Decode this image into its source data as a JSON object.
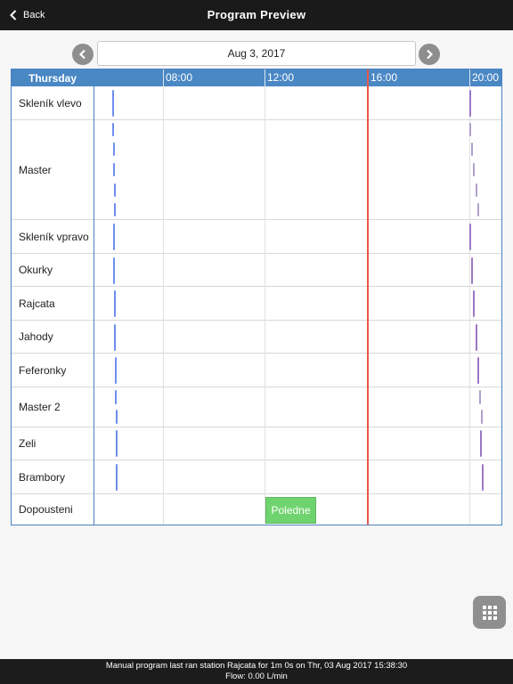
{
  "nav": {
    "back_label": "Back",
    "title": "Program Preview"
  },
  "date": {
    "value": "Aug 3, 2017"
  },
  "grid": {
    "day_label": "Thursday",
    "time_labels": [
      "08:00",
      "12:00",
      "16:00",
      "20:00"
    ],
    "rows": [
      {
        "label": "Skleník vlevo"
      },
      {
        "label": "Master"
      },
      {
        "label": "Skleník vpravo"
      },
      {
        "label": "Okurky"
      },
      {
        "label": "Rajcata"
      },
      {
        "label": "Jahody"
      },
      {
        "label": "Feferonky"
      },
      {
        "label": "Master 2"
      },
      {
        "label": "Zeli"
      },
      {
        "label": "Brambory"
      },
      {
        "label": "Dopousteni"
      }
    ],
    "event": {
      "label": "Poledne",
      "row": "Dopousteni",
      "color": "#6fd46f"
    },
    "colors": {
      "header": "#4a88c4",
      "now_line": "#e8574a",
      "morning_marks": "#6e8ef0",
      "evening_marks": "#9a78c4"
    }
  },
  "footer": {
    "line1": "Manual program last ran station Rajcata for 1m 0s on Thr, 03 Aug 2017 15:38:30",
    "line2": "Flow: 0.00 L/min"
  }
}
